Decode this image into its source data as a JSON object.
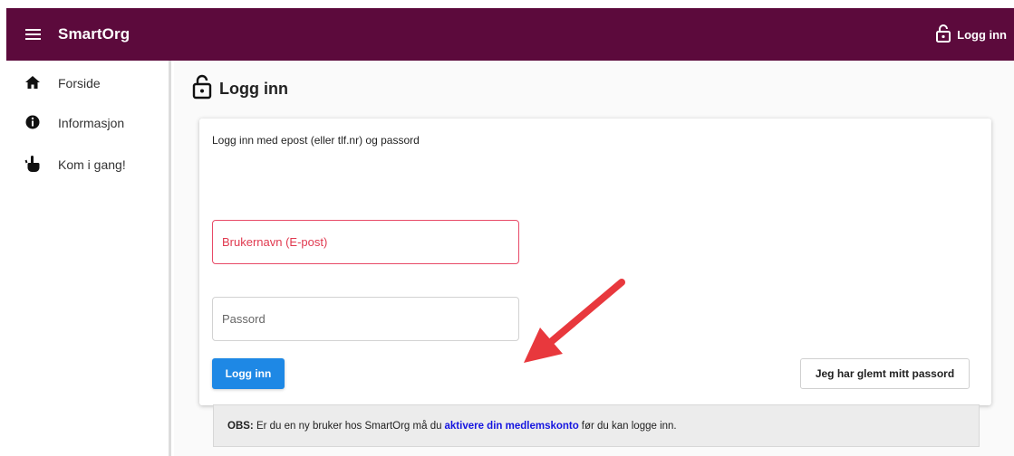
{
  "header": {
    "app_name": "SmartOrg",
    "login_label": "Logg inn",
    "bg_color": "#5c0a3c"
  },
  "sidebar": {
    "items": [
      {
        "label": "Forside",
        "icon": "home-icon"
      },
      {
        "label": "Informasjon",
        "icon": "info-icon"
      },
      {
        "label": "Kom i gang!",
        "icon": "pointing-hand-icon"
      }
    ]
  },
  "page": {
    "title": "Logg inn",
    "title_icon": "lock-icon"
  },
  "form": {
    "hint": "Logg inn med epost (eller tlf.nr) og passord",
    "username_placeholder": "Brukernavn (E-post)",
    "password_placeholder": "Passord",
    "login_button": "Logg inn",
    "forgot_button": "Jeg har glemt mitt passord",
    "accent_color": "#1e88e5",
    "error_color": "#e0394f"
  },
  "notice": {
    "prefix": "OBS:",
    "text_before": "Er du en ny bruker hos SmartOrg må du",
    "link": "aktivere din medlemskonto",
    "text_after": "før du kan logge inn."
  },
  "annotation": {
    "arrow_color": "#e8383d"
  }
}
